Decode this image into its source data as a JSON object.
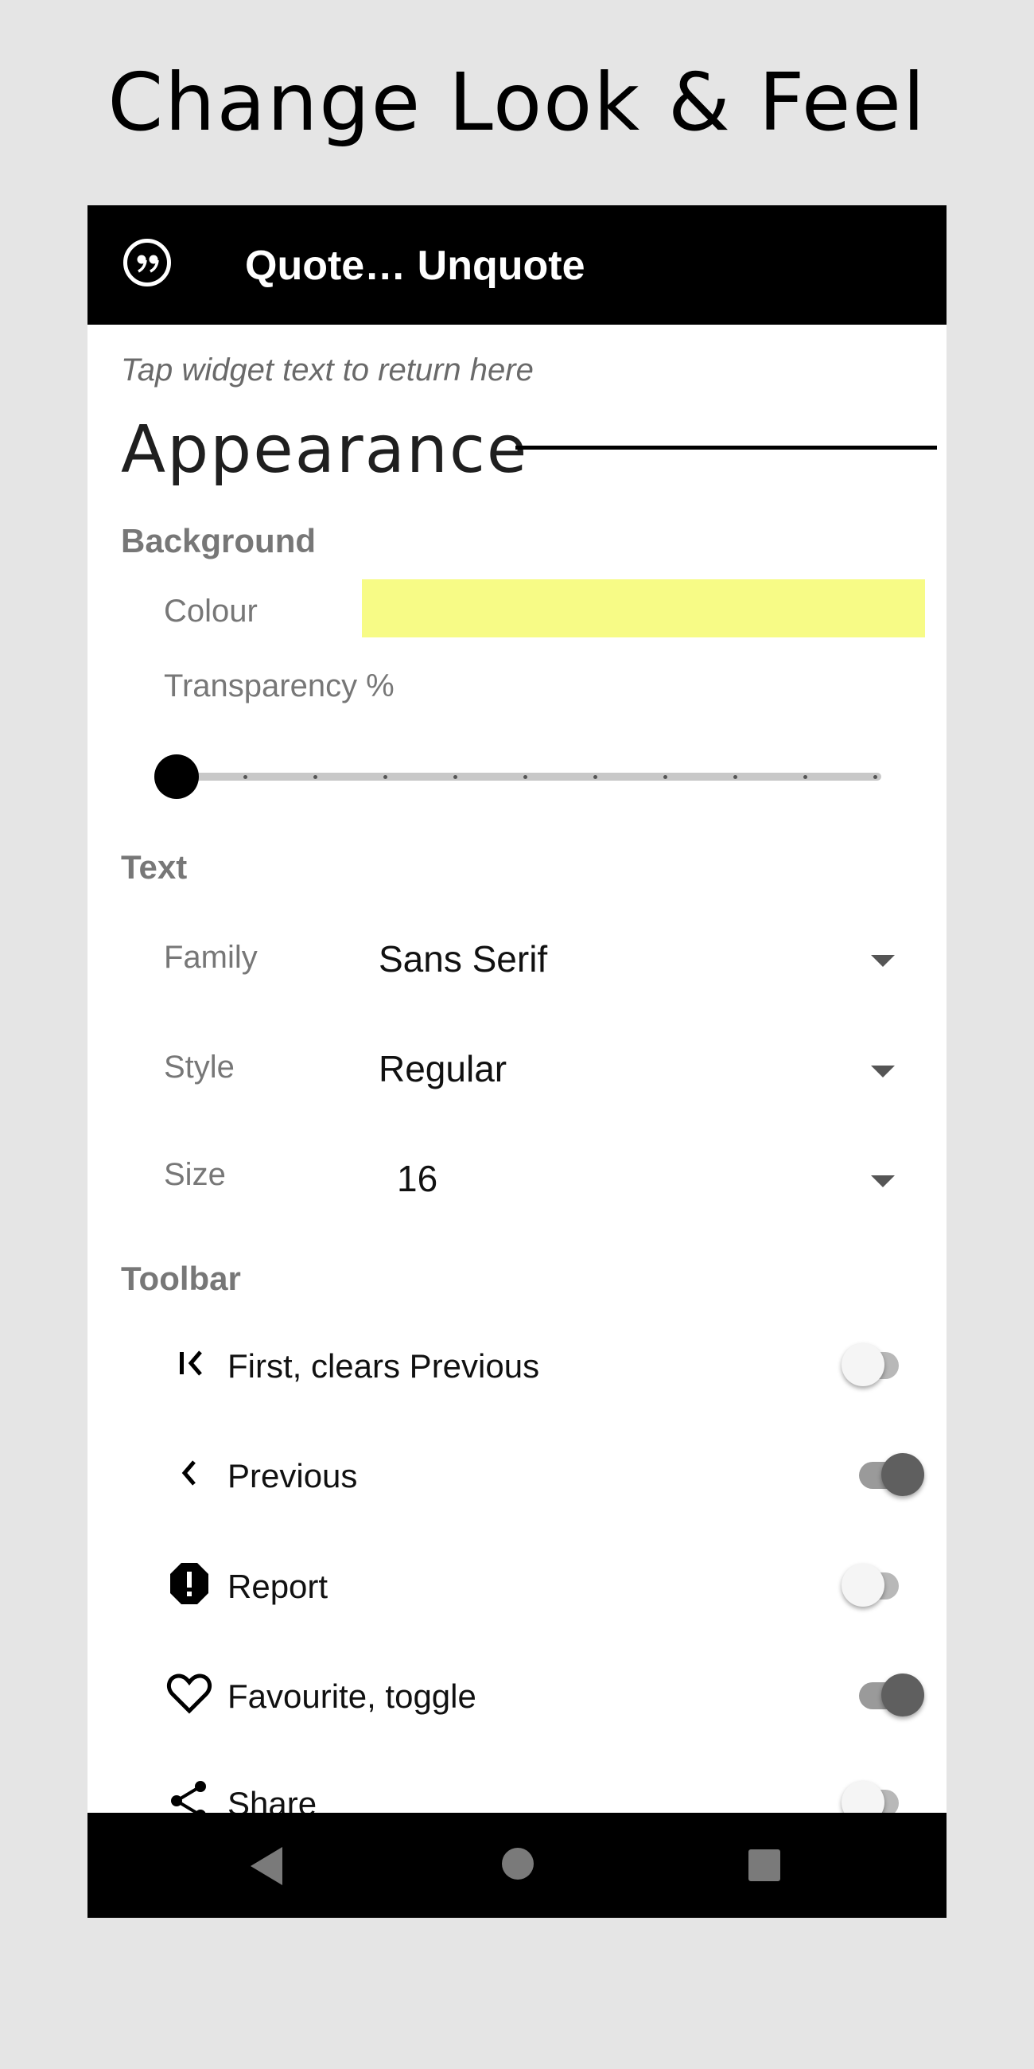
{
  "headline": "Change Look & Feel",
  "app_bar": {
    "title": "Quote… Unquote",
    "icon": "quote-icon"
  },
  "hint": "Tap widget text to return here",
  "section": {
    "title": "Appearance"
  },
  "background": {
    "label": "Background",
    "colour_label": "Colour",
    "colour_value": "#f7fb86",
    "transparency_label": "Transparency %",
    "transparency_value": 0
  },
  "text": {
    "label": "Text",
    "family_label": "Family",
    "family_value": "Sans Serif",
    "style_label": "Style",
    "style_value": "Regular",
    "size_label": "Size",
    "size_value": "16"
  },
  "toolbar": {
    "label": "Toolbar",
    "items": [
      {
        "label": "First, clears Previous",
        "icon": "first-icon",
        "on": false
      },
      {
        "label": "Previous",
        "icon": "chevron-left-icon",
        "on": true
      },
      {
        "label": "Report",
        "icon": "report-icon",
        "on": false
      },
      {
        "label": "Favourite, toggle",
        "icon": "heart-icon",
        "on": true
      },
      {
        "label": "Share",
        "icon": "share-icon",
        "on": false
      }
    ]
  },
  "nav_bar": {
    "icons": [
      "back-icon",
      "home-icon",
      "recents-icon"
    ]
  }
}
